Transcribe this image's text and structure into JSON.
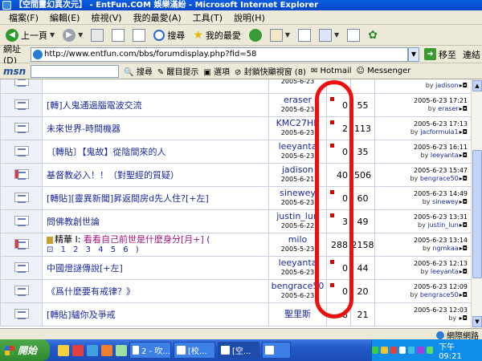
{
  "window": {
    "title": "【空間靈幻異次元】 - EntFun.COM 娛樂滿紛 - Microsoft Internet Explorer"
  },
  "menu": [
    "檔案(F)",
    "編輯(E)",
    "檢視(V)",
    "我的最愛(A)",
    "工具(T)",
    "說明(H)"
  ],
  "toolbar": {
    "back_label": "上一頁",
    "search_label": "搜尋",
    "favorites_label": "我的最愛"
  },
  "address": {
    "label": "網址(D)",
    "url": "http://www.entfun.com/bbs/forumdisplay.php?fid=58",
    "go_label": "移至",
    "links_label": "連結"
  },
  "msnbar": {
    "logo": "msn",
    "search_label": "搜尋",
    "highlight_label": "醒目提示",
    "options_label": "選項",
    "popup_label": "封鎖快顯視窗 (8)",
    "hotmail_label": "Hotmail",
    "messenger_label": "Messenger"
  },
  "rows": [
    {
      "topic": "",
      "author": "",
      "date": "2005-6-23",
      "replies": "",
      "views": "",
      "last_time": "",
      "last_by": "jadison",
      "dot": false
    },
    {
      "topic": "[轉]人鬼通過腦電波交流",
      "author": "eraser",
      "date": "2005-6-23",
      "replies": "0",
      "views": "55",
      "last_time": "2005-6-23 17:21",
      "last_by": "eraser",
      "dot": true
    },
    {
      "topic": "未來世界-時間機器",
      "author": "KMC27HK",
      "date": "2005-6-23",
      "replies": "2",
      "views": "113",
      "last_time": "2005-6-23 17:13",
      "last_by": "jacformula1",
      "dot": true
    },
    {
      "topic": "〔轉貼〕【鬼故】從陰間來的人",
      "author": "leeyanta",
      "date": "2005-6-23",
      "replies": "0",
      "views": "35",
      "last_time": "2005-6-23 16:11",
      "last_by": "leeyanta",
      "dot": true
    },
    {
      "topic": "基督教必入！！（對聖經的質疑）",
      "author": "jadison",
      "date": "2005-6-21",
      "replies": "40",
      "views": "506",
      "last_time": "2005-6-23 15:47",
      "last_by": "bengrace50",
      "dot": false
    },
    {
      "topic": "[轉貼][靈異新聞]昇返間房d先人住?[+左]",
      "author": "sinewey",
      "date": "2005-6-23",
      "replies": "0",
      "views": "60",
      "last_time": "2005-6-23 14:49",
      "last_by": "sinewey",
      "dot": true
    },
    {
      "topic": "問佛教創世論",
      "author": "justin_lun",
      "date": "2005-6-22",
      "replies": "3",
      "views": "49",
      "last_time": "2005-6-23 13:31",
      "last_by": "justin_lun",
      "dot": true
    },
    {
      "topic": "看看自己前世是什麼身分[月+]",
      "essence": "精華 I:",
      "pages": "1 2 3 4 5 6 )",
      "author": "milo",
      "date": "2005-5-23",
      "replies": "288",
      "views": "2158",
      "last_time": "2005-6-23 13:14",
      "last_by": "ngmkaa",
      "dot": false
    },
    {
      "topic": "中國燈謎傳說[+左]",
      "author": "leeyanta",
      "date": "2005-6-23",
      "replies": "0",
      "views": "44",
      "last_time": "2005-6-23 12:13",
      "last_by": "leeyanta",
      "dot": true
    },
    {
      "topic": "《爲什麼要有戒律？》",
      "author": "bengrace50",
      "date": "2005-6-23",
      "replies": "0",
      "views": "20",
      "last_time": "2005-6-23 12:09",
      "last_by": "bengrace50",
      "dot": true
    },
    {
      "topic": "[轉貼]驢你及爭戒",
      "author": "聖里斯",
      "date": "",
      "replies": "8",
      "views": "21",
      "last_time": "2005-6-23 12:03",
      "last_by": "",
      "dot": false
    }
  ],
  "labels": {
    "by": "by",
    "paren_open": "("
  },
  "status": {
    "zone": "網際網路"
  },
  "taskbar": {
    "start_label": "開始",
    "tasks": [
      "2 - 吹...",
      "[校...",
      "[空...",
      ""
    ],
    "clock": "下午 09:21"
  }
}
